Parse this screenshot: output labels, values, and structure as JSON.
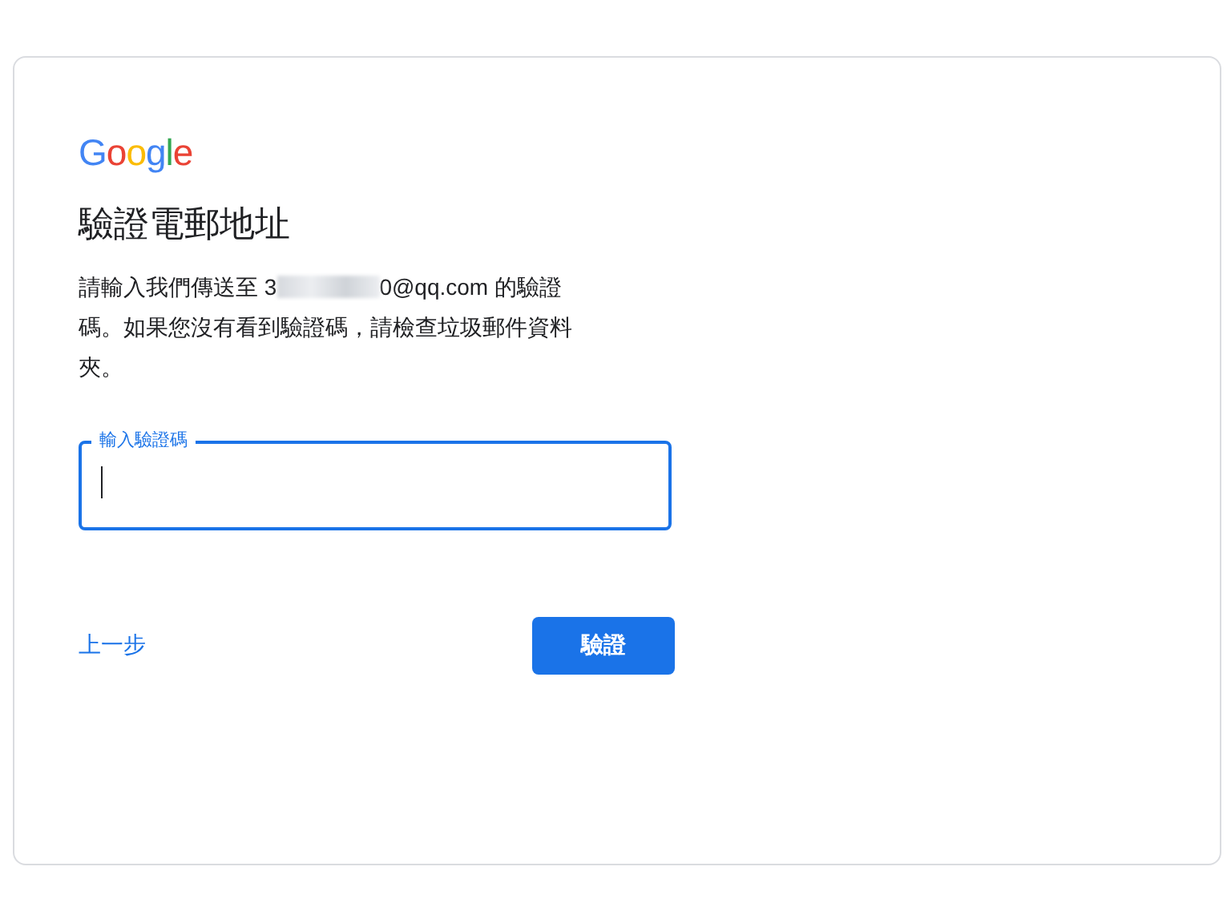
{
  "logo": "Google",
  "title": "驗證電郵地址",
  "description": {
    "before": "請輸入我們傳送至 3",
    "redacted": true,
    "after": "0@qq.com 的驗證碼。如果您沒有看到驗證碼，請檢查垃圾郵件資料夾。"
  },
  "code_field": {
    "label": "輸入驗證碼",
    "focused": true
  },
  "back_link": "上一步",
  "verify_button": "驗證"
}
